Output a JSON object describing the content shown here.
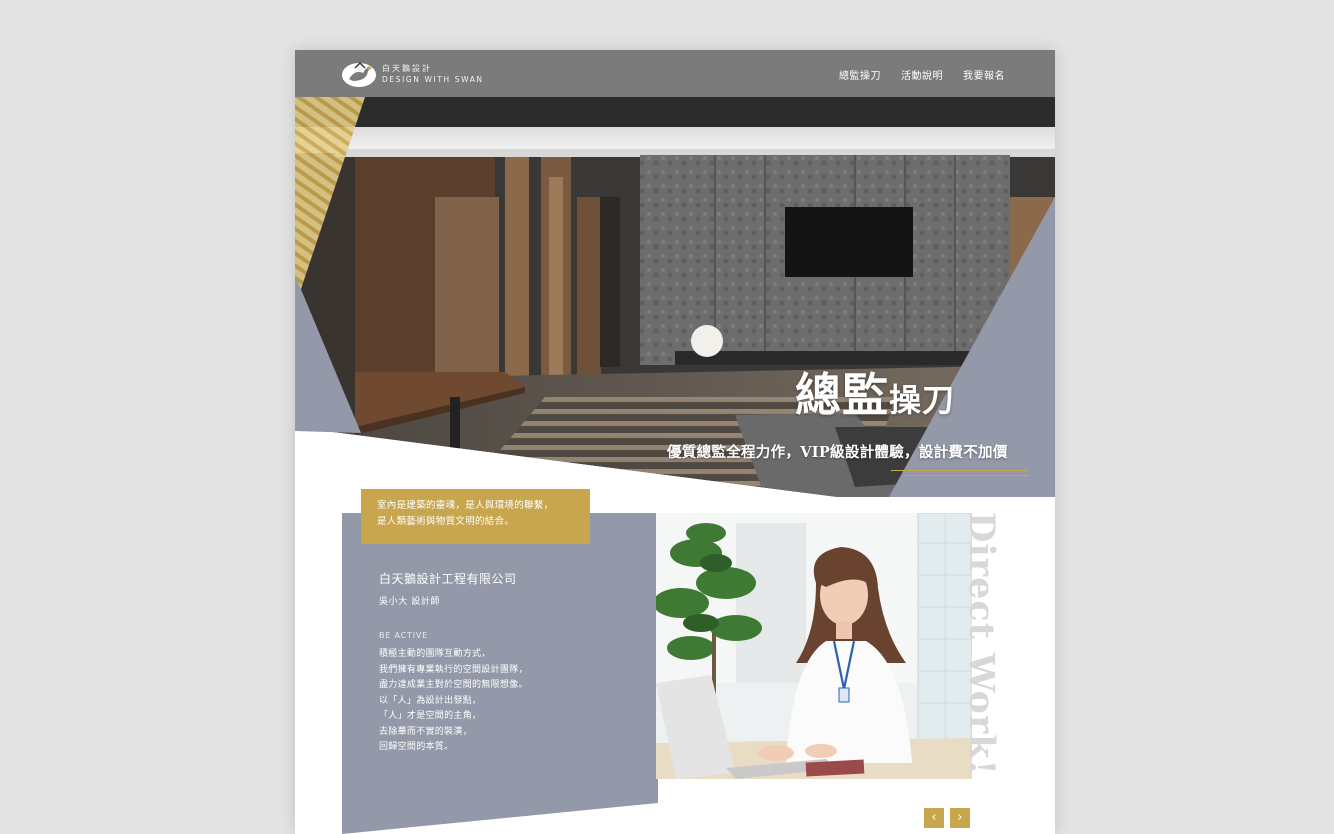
{
  "header": {
    "logo_zh": "白天鵝設計",
    "logo_en": "DESIGN WITH SWAN",
    "nav": [
      "總監操刀",
      "活動說明",
      "我要報名"
    ]
  },
  "hero": {
    "title_big": "總監",
    "title_small": "操刀",
    "subtitle": "優質總監全程力作，VIP級設計體驗，設計費不加價"
  },
  "intro": {
    "quote": [
      "室內是建築的靈魂，是人與環境的聯繫，",
      "是人類藝術與物質文明的結合。"
    ],
    "company": "白天鵝設計工程有限公司",
    "person": "吳小大 設計師",
    "tag": "BE ACTIVE",
    "paragraph": [
      "積極主動的團隊互動方式，",
      "我們擁有專業執行的空間設計團隊，",
      "盡力達成業主對於空間的無限想像。",
      "以「人」為設計出發點，",
      "「人」才是空間的主角，",
      "去除華而不實的裝潢，",
      "回歸空間的本質。"
    ],
    "vertical_text": "Direct Work!",
    "prev": "‹",
    "next": "›"
  },
  "colors": {
    "nav_bg": "#7b7b7b",
    "slate": "#9499a9",
    "gold": "#c8a64e"
  }
}
